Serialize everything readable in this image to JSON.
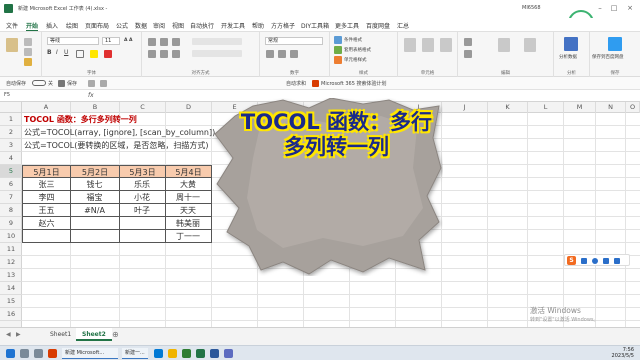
{
  "titlebar": {
    "title": "新建 Microsoft Excel 工作表 (4).xlsx -",
    "user": "MI6568"
  },
  "menu_tabs": [
    "文件",
    "开始",
    "插入",
    "绘图",
    "页面布局",
    "公式",
    "数据",
    "审阅",
    "视图",
    "自动执行",
    "开发工具",
    "帮助",
    "方方格子",
    "DIY工具箱",
    "更多工具",
    "百度网盘",
    "汇总"
  ],
  "active_tab": "开始",
  "ribbon": {
    "font_name": "等线",
    "font_size": "11",
    "font_group_label": "字体",
    "align_group_label": "对齐方式",
    "number_group_label": "数字",
    "number_format": "常规",
    "cond_format_label": "条件格式",
    "table_format_label": "套用表格格式",
    "cell_style_label": "单元格样式",
    "analyze_label": "分析数据",
    "baidu_label": "保存到百度网盘",
    "style_group_label": "样式",
    "cells_group_label": "单元格",
    "edit_group_label": "编辑",
    "analyze_group_label": "分析",
    "save_group_label": "保存"
  },
  "autosave": {
    "label": "自动保存",
    "toggle": "关",
    "save_label": "保存",
    "search_label": "自动求和",
    "m365_label": "Microsoft 365 搜索体验计划"
  },
  "formulabar": {
    "namebox": "F5",
    "fx": "fx"
  },
  "columns": [
    "A",
    "B",
    "C",
    "D",
    "E",
    "F",
    "G",
    "H",
    "I",
    "J",
    "K",
    "L",
    "M",
    "N",
    "O"
  ],
  "rows": [
    "1",
    "2",
    "3",
    "4",
    "5",
    "6",
    "7",
    "8",
    "9",
    "10",
    "11",
    "12",
    "13",
    "14",
    "15",
    "16"
  ],
  "selected_row": "5",
  "sheet": {
    "title_text": "TOCOL 函数：多行多列转一列",
    "formula1": "公式=TOCOL(array, [ignore], [scan_by_column])",
    "formula2": "公式=TOCOL(要转换的区域，是否忽略，扫描方式)",
    "headers": [
      "5月1日",
      "5月2日",
      "5月3日",
      "5月4日"
    ],
    "data": [
      [
        "张三",
        "钱七",
        "乐乐",
        "大黄"
      ],
      [
        "李四",
        "福宝",
        "小花",
        "周十一"
      ],
      [
        "王五",
        "#N/A",
        "叶子",
        "天天"
      ],
      [
        "赵六",
        "",
        "",
        "韩美丽"
      ],
      [
        "",
        "",
        "",
        "丁一一"
      ]
    ],
    "title_color": "#c00000",
    "header_fill": "#f8cbad"
  },
  "overlay": {
    "text": "TOCOL 函数：多行多列转一列"
  },
  "zoom_badge": "48",
  "sheet_tabs": [
    "Sheet1",
    "Sheet2"
  ],
  "active_sheet": "Sheet2",
  "watermark": {
    "line1": "激活 Windows",
    "line2": "转到\"设置\"以激活 Windows。"
  },
  "taskbar": {
    "task1": "新建 Microsoft...",
    "task2": "新建一...",
    "time": "7:56",
    "date": "2023/5/5"
  },
  "sogou_label": "S"
}
